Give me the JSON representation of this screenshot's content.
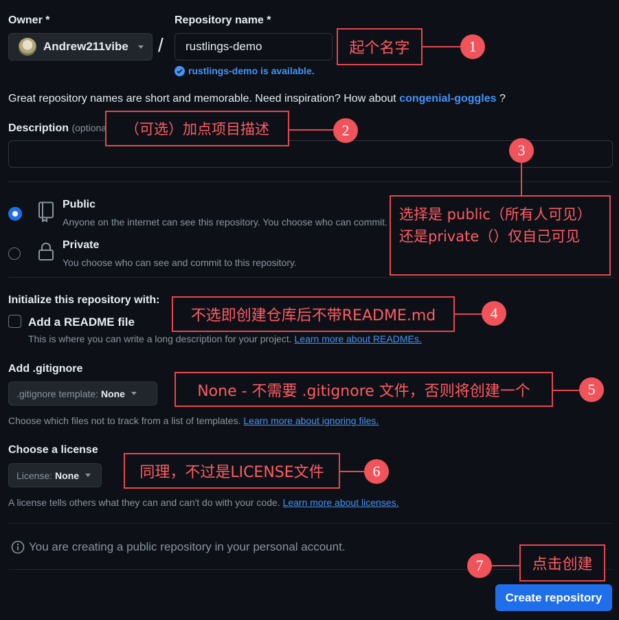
{
  "owner": {
    "label": "Owner *",
    "value": "Andrew211vibe"
  },
  "repo": {
    "label": "Repository name *",
    "value": "rustlings-demo",
    "available": "rustlings-demo is available."
  },
  "separator": "/",
  "hint": {
    "text": "Great repository names are short and memorable. Need inspiration? How about ",
    "suggestion": "congenial-goggles",
    "end": " ?"
  },
  "description": {
    "label": "Description",
    "optional": "(optional)",
    "value": ""
  },
  "visibility": {
    "public": {
      "title": "Public",
      "desc": "Anyone on the internet can see this repository. You choose who can commit.",
      "selected": true
    },
    "private": {
      "title": "Private",
      "desc": "You choose who can see and commit to this repository.",
      "selected": false
    }
  },
  "init": {
    "heading": "Initialize this repository with:",
    "readme_label": "Add a README file",
    "readme_desc": "This is where you can write a long description for your project. ",
    "readme_link": "Learn more about READMEs.",
    "readme_checked": false
  },
  "gitignore": {
    "heading": "Add .gitignore",
    "select_label": ".gitignore template: ",
    "select_value": "None",
    "desc": "Choose which files not to track from a list of templates. ",
    "link": "Learn more about ignoring files."
  },
  "license": {
    "heading": "Choose a license",
    "select_label": "License: ",
    "select_value": "None",
    "desc": "A license tells others what they can and can't do with your code. ",
    "link": "Learn more about licenses."
  },
  "notice": "You are creating a public repository in your personal account.",
  "create_button": "Create repository",
  "annotations": {
    "a1": {
      "num": "1",
      "text": "起个名字"
    },
    "a2": {
      "num": "2",
      "text": "（可选）加点项目描述"
    },
    "a3": {
      "num": "3",
      "text": "选择是 public（所有人可见）还是private（）仅自己可见"
    },
    "a4": {
      "num": "4",
      "text": "不选即创建仓库后不带README.md"
    },
    "a5": {
      "num": "5",
      "text": "None - 不需要 .gitignore 文件，否则将创建一个"
    },
    "a6": {
      "num": "6",
      "text": "同理，不过是LICENSE文件"
    },
    "a7": {
      "num": "7",
      "text": "点击创建"
    }
  },
  "colors": {
    "accent": "#4493f8",
    "annotation": "#e5484d",
    "button": "#1f6feb"
  }
}
